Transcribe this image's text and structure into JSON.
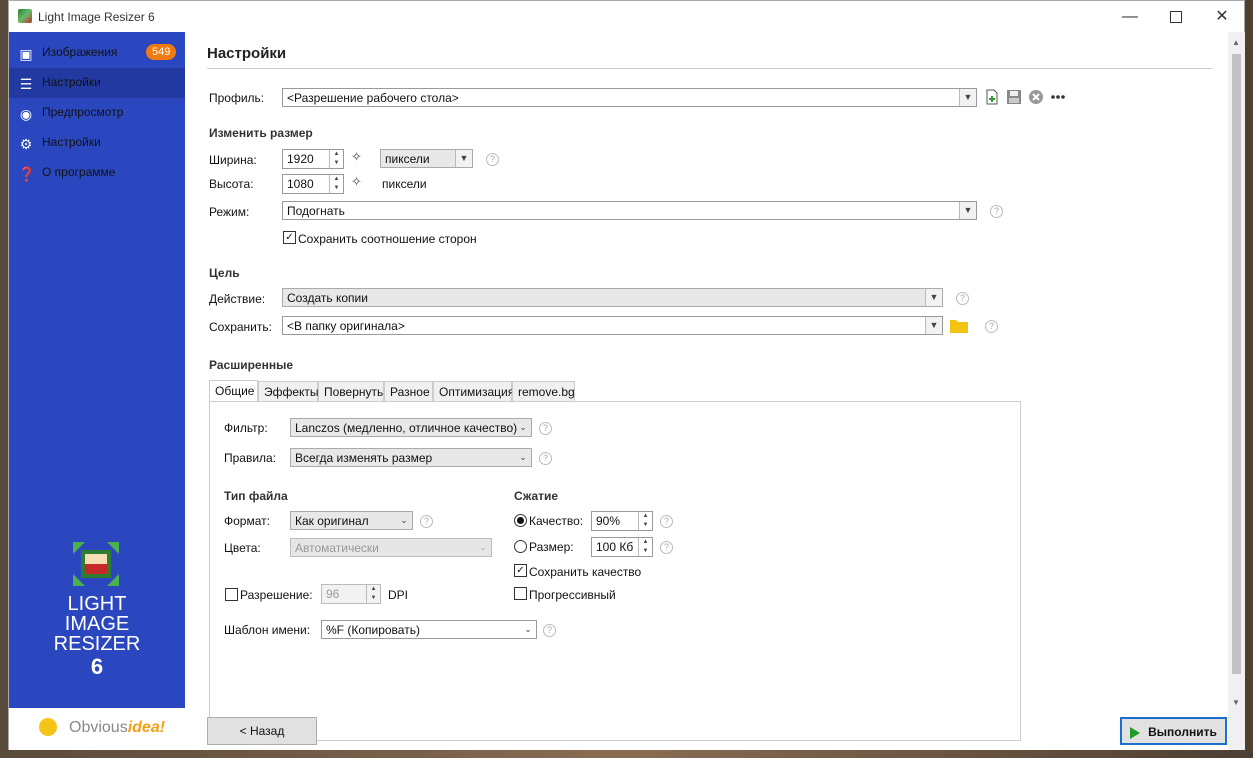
{
  "window": {
    "title": "Light Image Resizer 6"
  },
  "sidebar": {
    "items": [
      {
        "label": "Изображения",
        "icon": "images-icon",
        "badge": "549"
      },
      {
        "label": "Настройки",
        "icon": "sliders-icon",
        "active": true
      },
      {
        "label": "Предпросмотр",
        "icon": "eye-icon"
      },
      {
        "label": "Настройки",
        "icon": "gear-icon"
      },
      {
        "label": "О программе",
        "icon": "info-icon"
      }
    ],
    "logo": {
      "line1": "LIGHT",
      "line2": "IMAGE",
      "line3": "RESIZER",
      "num": "6"
    },
    "brand": {
      "part1": "Obvious",
      "part2": "idea!"
    }
  },
  "page": {
    "title": "Настройки"
  },
  "profile": {
    "label": "Профиль:",
    "value": "<Разрешение рабочего стола>"
  },
  "resize": {
    "section": "Изменить размер",
    "width_label": "Ширина:",
    "width": "1920",
    "height_label": "Высота:",
    "height": "1080",
    "unit": "пиксели",
    "unit_text": "пиксели",
    "mode_label": "Режим:",
    "mode": "Подогнать",
    "keep_ratio": "Сохранить соотношение сторон"
  },
  "target": {
    "section": "Цель",
    "action_label": "Действие:",
    "action": "Создать копии",
    "save_label": "Сохранить:",
    "save": "<В папку оригинала>"
  },
  "advanced": {
    "section": "Расширенные",
    "tabs": [
      "Общие",
      "Эффекты",
      "Повернуть",
      "Разное",
      "Оптимизация",
      "remove.bg"
    ],
    "filter_label": "Фильтр:",
    "filter": "Lanczos  (медленно, отличное качество)",
    "rules_label": "Правила:",
    "rules": "Всегда изменять размер",
    "filetype_section": "Тип файла",
    "format_label": "Формат:",
    "format": "Как оригинал",
    "colors_label": "Цвета:",
    "colors": "Автоматически",
    "resolution_label": "Разрешение:",
    "resolution": "96",
    "dpi": "DPI",
    "template_label": "Шаблон имени:",
    "template": "%F (Копировать)",
    "compression_section": "Сжатие",
    "quality_label": "Качество:",
    "quality": "90%",
    "size_label": "Размер:",
    "size": "100 Кб",
    "keep_quality": "Сохранить качество",
    "progressive": "Прогрессивный"
  },
  "buttons": {
    "back": "< Назад",
    "run": "Выполнить"
  },
  "colors": {
    "sidebar": "#2a47c0",
    "sidebar_active": "#2239a2",
    "badge": "#f07a10",
    "run_play": "#1e9b2a"
  }
}
